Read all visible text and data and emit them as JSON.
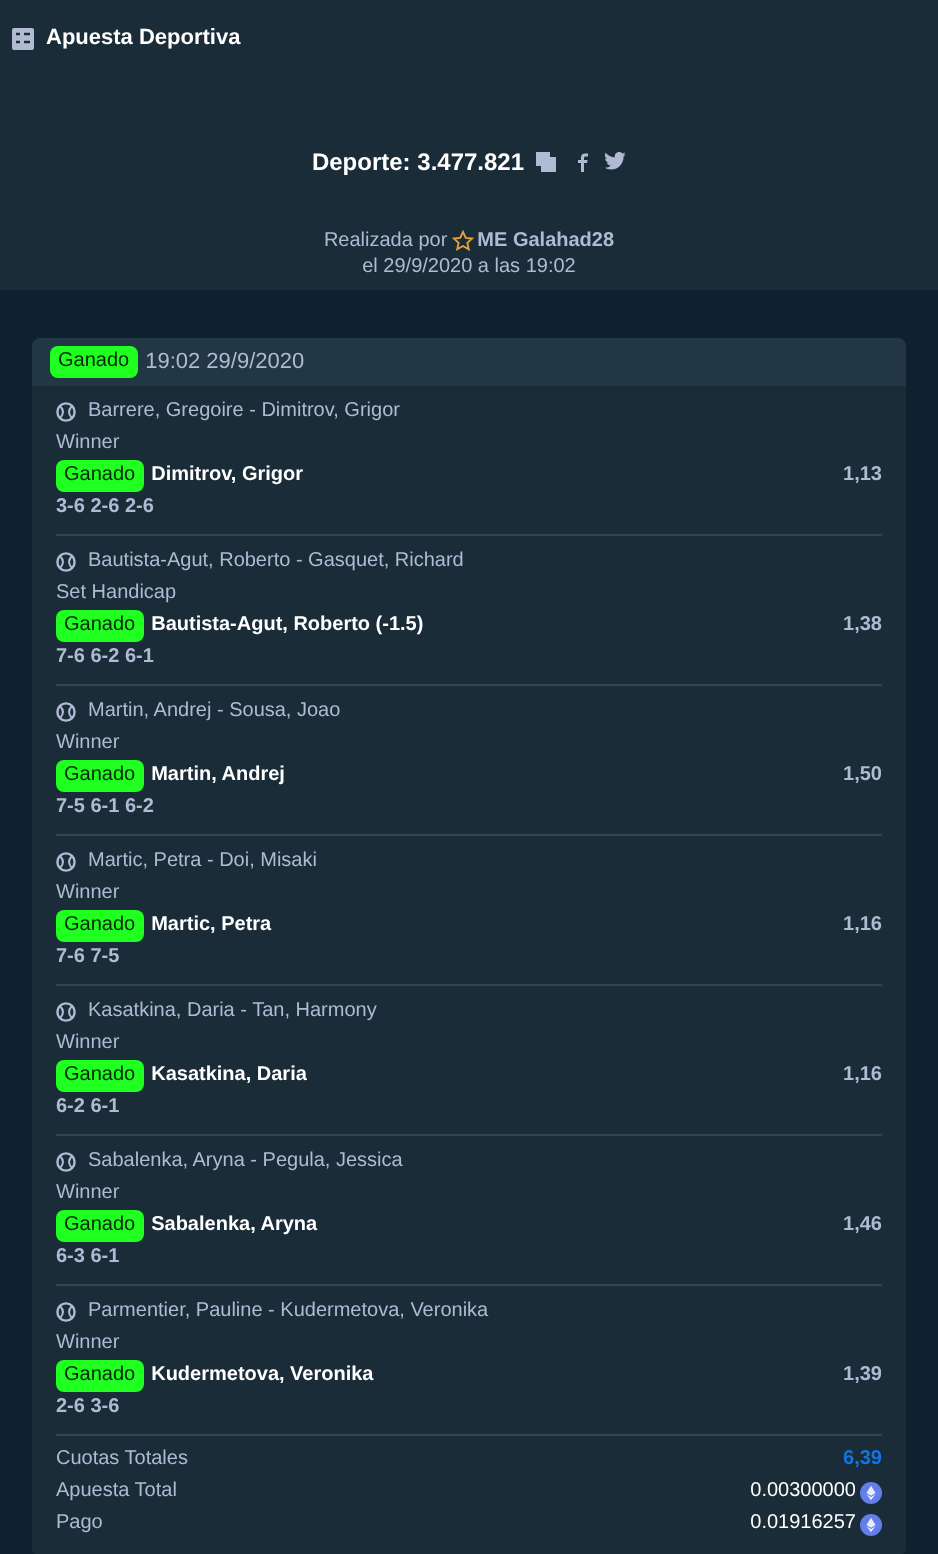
{
  "title": "Apuesta Deportiva",
  "bet_id": "Deporte: 3.477.821",
  "placed_by_prefix": "Realizada por",
  "user": "ME Galahad28",
  "placed_at": "el 29/9/2020 a las 19:02",
  "slip": {
    "status": "Ganado",
    "time": "19:02 29/9/2020"
  },
  "legs": [
    {
      "event": "Barrere, Gregoire - Dimitrov, Grigor",
      "market": "Winner",
      "status": "Ganado",
      "pick": "Dimitrov, Grigor",
      "odds": "1,13",
      "score": "3-6 2-6 2-6"
    },
    {
      "event": "Bautista-Agut, Roberto - Gasquet, Richard",
      "market": "Set Handicap",
      "status": "Ganado",
      "pick": "Bautista-Agut, Roberto (-1.5)",
      "odds": "1,38",
      "score": "7-6 6-2 6-1"
    },
    {
      "event": "Martin, Andrej - Sousa, Joao",
      "market": "Winner",
      "status": "Ganado",
      "pick": "Martin, Andrej",
      "odds": "1,50",
      "score": "7-5 6-1 6-2"
    },
    {
      "event": "Martic, Petra - Doi, Misaki",
      "market": "Winner",
      "status": "Ganado",
      "pick": "Martic, Petra",
      "odds": "1,16",
      "score": "7-6 7-5"
    },
    {
      "event": "Kasatkina, Daria - Tan, Harmony",
      "market": "Winner",
      "status": "Ganado",
      "pick": "Kasatkina, Daria",
      "odds": "1,16",
      "score": "6-2 6-1"
    },
    {
      "event": "Sabalenka, Aryna - Pegula, Jessica",
      "market": "Winner",
      "status": "Ganado",
      "pick": "Sabalenka, Aryna",
      "odds": "1,46",
      "score": "6-3 6-1"
    },
    {
      "event": "Parmentier, Pauline - Kudermetova, Veronika",
      "market": "Winner",
      "status": "Ganado",
      "pick": "Kudermetova, Veronika",
      "odds": "1,39",
      "score": "2-6 3-6"
    }
  ],
  "summary": [
    {
      "kind": "odds",
      "label": "Cuotas Totales",
      "value": "6,39"
    },
    {
      "kind": "amount",
      "label": "Apuesta Total",
      "value": "0.00300000"
    },
    {
      "kind": "amount",
      "label": "Pago",
      "value": "0.01916257"
    }
  ]
}
